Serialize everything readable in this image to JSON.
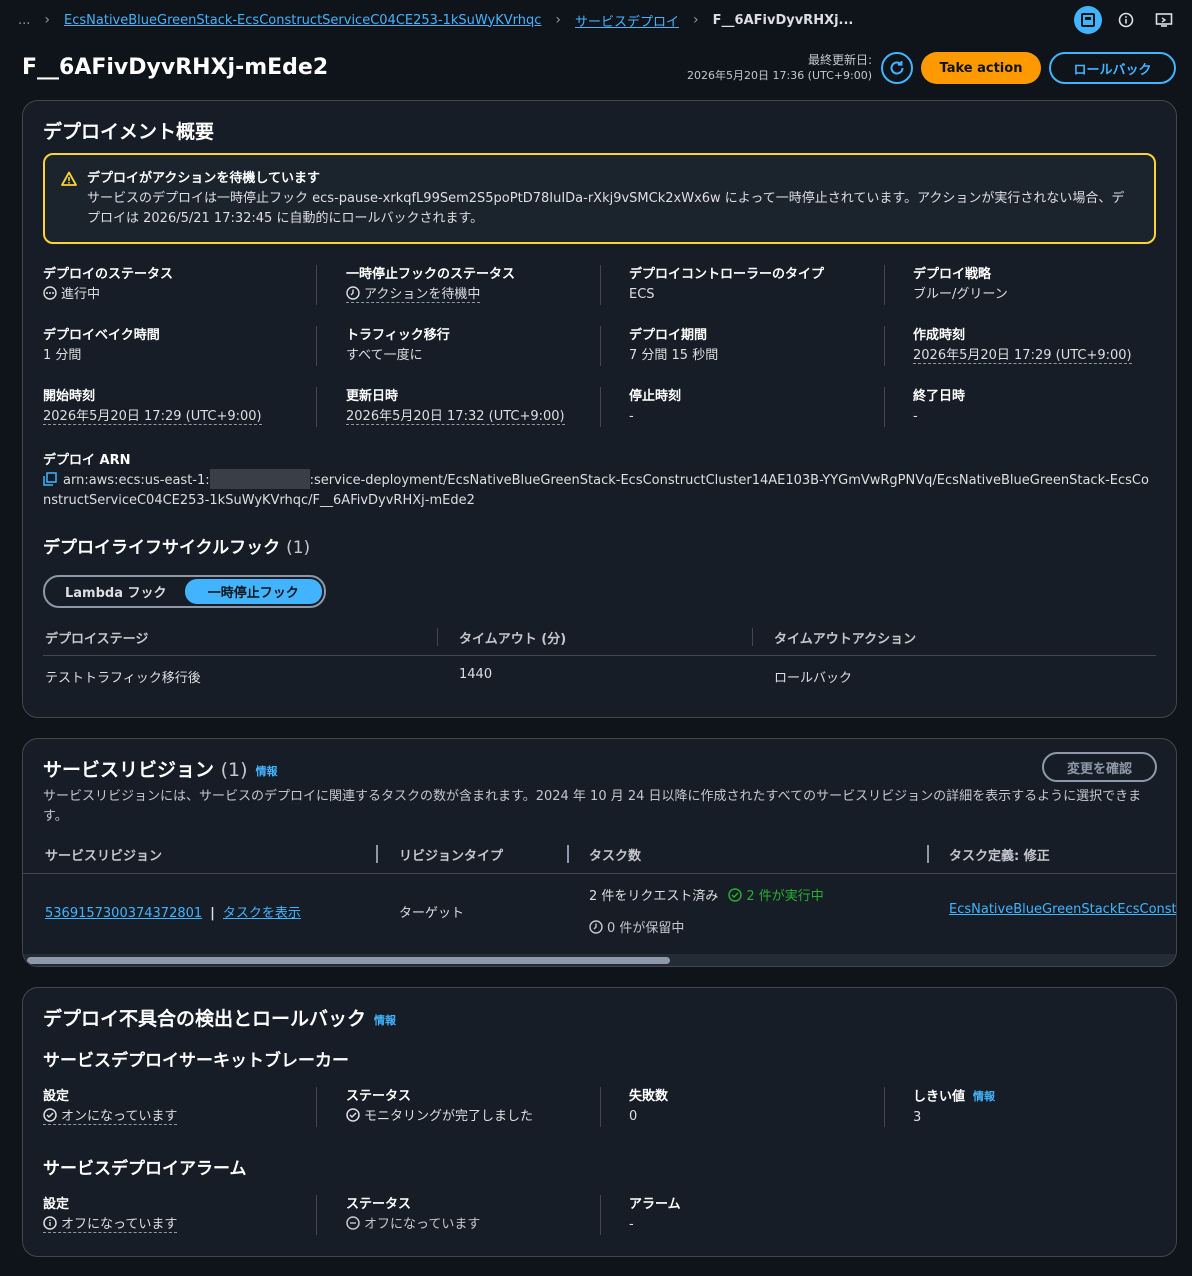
{
  "breadcrumb": {
    "ellipsis": "...",
    "service": "EcsNativeBlueGreenStack-EcsConstructServiceC04CE253-1kSuWyKVrhqc",
    "deployments": "サービスデプロイ",
    "current": "F__6AFivDyvRHXj..."
  },
  "header": {
    "title": "F__6AFivDyvRHXj-mEde2",
    "last_updated_label": "最終更新日:",
    "last_updated_value": "2026年5月20日 17:36 (UTC+9:00)",
    "take_action": "Take action",
    "rollback": "ロールバック"
  },
  "overview": {
    "title": "デプロイメント概要",
    "alert": {
      "title": "デプロイがアクションを待機しています",
      "body": "サービスのデプロイは一時停止フック ecs-pause-xrkqfL99Sem2S5poPtD78IuIDa-rXkj9vSMCk2xWx6w によって一時停止されています。アクションが実行されない場合、デプロイは 2026/5/21 17:32:45 に自動的にロールバックされます。"
    },
    "fields": {
      "status": {
        "k": "デプロイのステータス",
        "v": "進行中"
      },
      "pause_status": {
        "k": "一時停止フックのステータス",
        "v": "アクションを待機中"
      },
      "controller": {
        "k": "デプロイコントローラーのタイプ",
        "v": "ECS"
      },
      "strategy": {
        "k": "デプロイ戦略",
        "v": "ブルー/グリーン"
      },
      "bake": {
        "k": "デプロイベイク時間",
        "v": "1 分間"
      },
      "traffic": {
        "k": "トラフィック移行",
        "v": "すべて一度に"
      },
      "duration": {
        "k": "デプロイ期間",
        "v": "7 分間 15 秒間"
      },
      "created": {
        "k": "作成時刻",
        "v": "2026年5月20日 17:29 (UTC+9:00)"
      },
      "started": {
        "k": "開始時刻",
        "v": "2026年5月20日 17:29 (UTC+9:00)"
      },
      "updated": {
        "k": "更新日時",
        "v": "2026年5月20日 17:32 (UTC+9:00)"
      },
      "stopped": {
        "k": "停止時刻",
        "v": "-"
      },
      "ended": {
        "k": "終了日時",
        "v": "-"
      }
    },
    "arn_label": "デプロイ ARN",
    "arn_prefix": "arn:aws:ecs:us-east-1:",
    "arn_suffix": ":service-deployment/EcsNativeBlueGreenStack-EcsConstructCluster14AE103B-YYGmVwRgPNVq/EcsNativeBlueGreenStack-EcsConstructServiceC04CE253-1kSuWyKVrhqc/F__6AFivDyvRHXj-mEde2",
    "lifecycle": {
      "title": "デプロイライフサイクルフック",
      "count": "(1)",
      "tabs": [
        "Lambda フック",
        "一時停止フック"
      ],
      "columns": [
        "デプロイステージ",
        "タイムアウト (分)",
        "タイムアウトアクション"
      ],
      "rows": [
        [
          "テストトラフィック移行後",
          "1440",
          "ロールバック"
        ]
      ]
    }
  },
  "revisions": {
    "title": "サービスリビジョン",
    "count": "(1)",
    "info": "情報",
    "review_button": "変更を確認",
    "description": "サービスリビジョンには、サービスのデプロイに関連するタスクの数が含まれます。2024 年 10 月 24 日以降に作成されたすべてのサービスリビジョンの詳細を表示するように選択できます。",
    "columns": [
      "サービスリビジョン",
      "リビジョンタイプ",
      "タスク数",
      "タスク定義: 修正"
    ],
    "row": {
      "revision_id": "5369157300374372801",
      "divider": "|",
      "view_tasks": "タスクを表示",
      "type": "ターゲット",
      "requested": "2 件をリクエスト済み",
      "running": "2 件が実行中",
      "pending": "0 件が保留中",
      "task_def": "EcsNativeBlueGreenStackEcsConstru"
    }
  },
  "detection": {
    "title": "デプロイ不具合の検出とロールバック",
    "info": "情報",
    "circuit_title": "サービスデプロイサーキットブレーカー",
    "circuit": {
      "setting": {
        "k": "設定",
        "v": "オンになっています"
      },
      "status": {
        "k": "ステータス",
        "v": "モニタリングが完了しました"
      },
      "failures": {
        "k": "失敗数",
        "v": "0"
      },
      "threshold": {
        "k": "しきい値",
        "v": "3",
        "info": "情報"
      }
    },
    "alarm_title": "サービスデプロイアラーム",
    "alarm": {
      "setting": {
        "k": "設定",
        "v": "オフになっています"
      },
      "status": {
        "k": "ステータス",
        "v": "オフになっています"
      },
      "alarms": {
        "k": "アラーム",
        "v": "-"
      }
    }
  }
}
